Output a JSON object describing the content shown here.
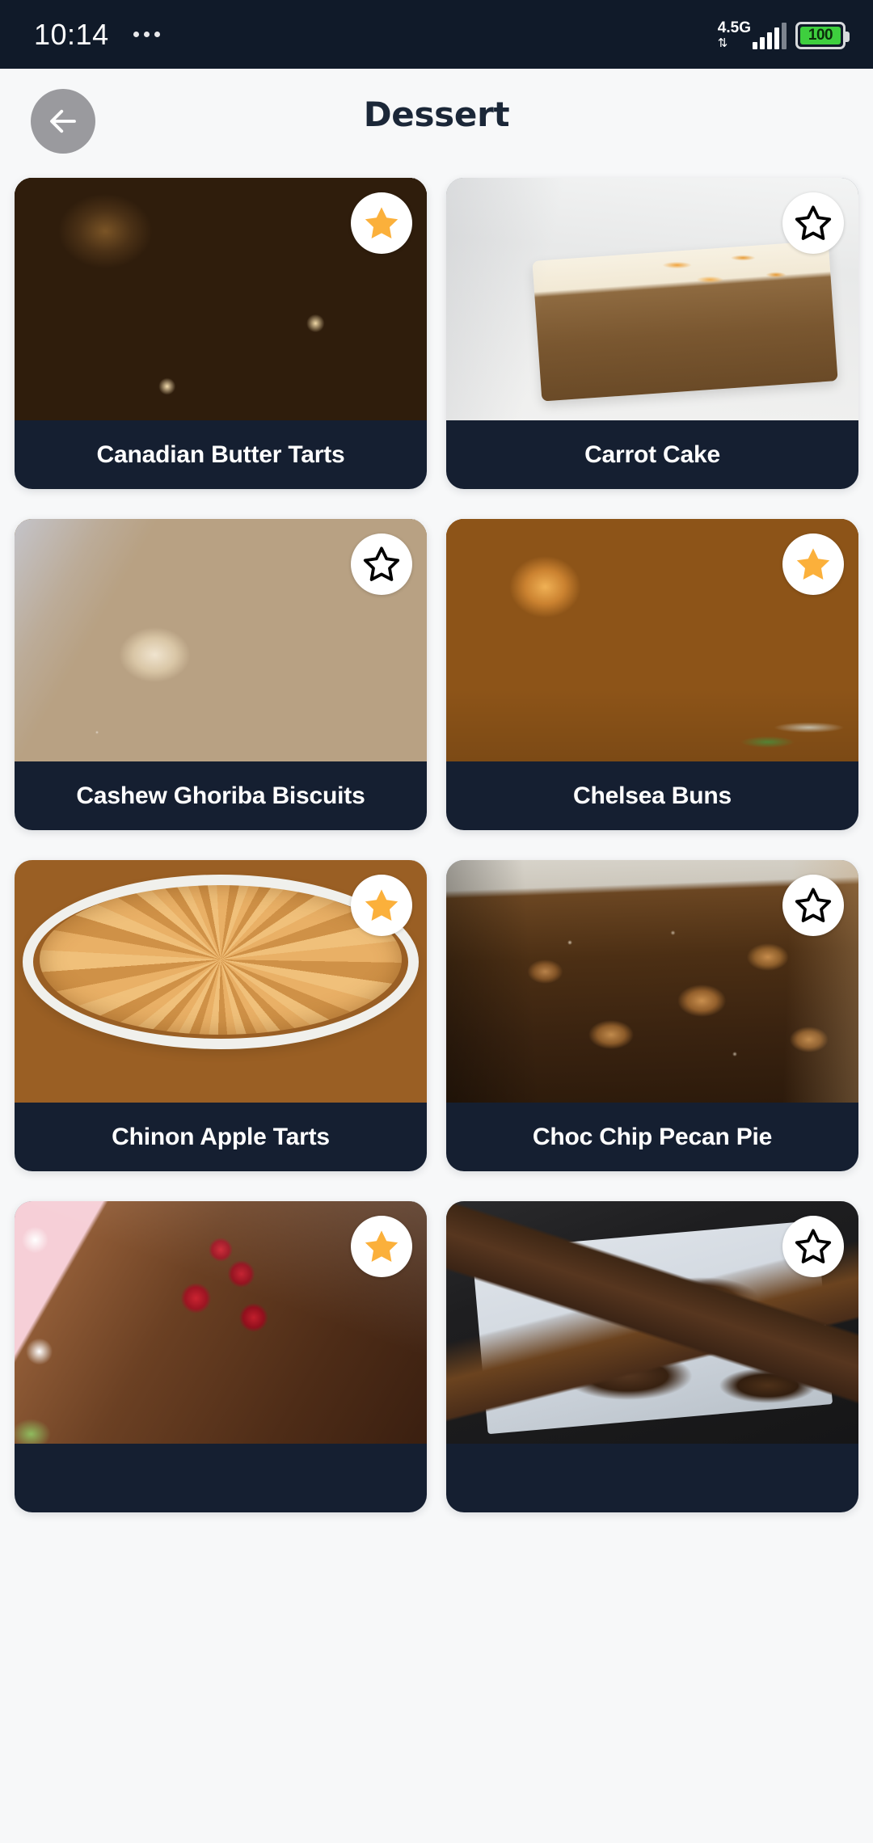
{
  "status_bar": {
    "time": "10:14",
    "notification_icon": "more-dots-icon",
    "network_label": "4.5G",
    "network_arrows": "⇅",
    "signal_icon": "signal-bars-icon",
    "battery_level": "100"
  },
  "header": {
    "back_icon": "arrow-left-icon",
    "title": "Dessert"
  },
  "colors": {
    "page_background": "#f7f8f9",
    "card_label_background": "#151f31",
    "title_text": "#1b2738",
    "star_filled": "#fbb03b",
    "star_outline": "#000000",
    "back_button": "#9a9a9e",
    "status_bar_background": "#101a29",
    "battery_green": "#3ecf3e"
  },
  "recipes": [
    {
      "name": "Canadian Butter Tarts",
      "favorite": true,
      "star_icon": "star-filled-icon",
      "photo_class": "ph-tarts"
    },
    {
      "name": "Carrot Cake",
      "favorite": false,
      "star_icon": "star-outline-icon",
      "photo_class": "ph-carrotcake"
    },
    {
      "name": "Cashew Ghoriba Biscuits",
      "favorite": false,
      "star_icon": "star-outline-icon",
      "photo_class": "ph-ghoriba"
    },
    {
      "name": "Chelsea Buns",
      "favorite": true,
      "star_icon": "star-filled-icon",
      "photo_class": "ph-chelsea"
    },
    {
      "name": "Chinon Apple Tarts",
      "favorite": true,
      "star_icon": "star-filled-icon",
      "photo_class": "ph-appletart"
    },
    {
      "name": "Choc Chip Pecan Pie",
      "favorite": false,
      "star_icon": "star-outline-icon",
      "photo_class": "ph-pecanpie"
    },
    {
      "name": "",
      "favorite": true,
      "star_icon": "star-filled-icon",
      "photo_class": "ph-mousse"
    },
    {
      "name": "",
      "favorite": false,
      "star_icon": "star-outline-icon",
      "photo_class": "ph-bark"
    }
  ]
}
